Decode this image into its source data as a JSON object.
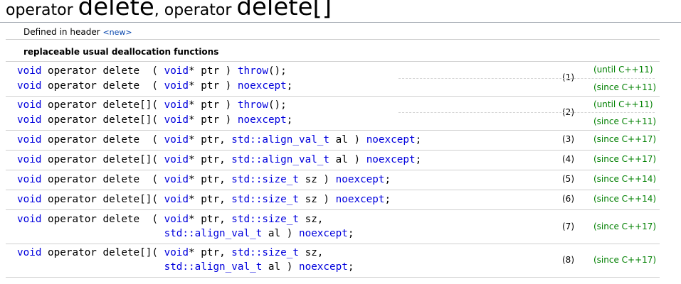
{
  "title": {
    "part1_small": "operator ",
    "part1_big": "delete",
    "sep": ", ",
    "part2_small": "operator ",
    "part2_big": "delete[]"
  },
  "header": {
    "label": "Defined in header ",
    "link": "<new>"
  },
  "section": {
    "title": "replaceable usual deallocation functions"
  },
  "tokens": {
    "void": "void",
    "op_delete": " operator delete  ",
    "op_delete_arr": " operator delete[]",
    "open": "( ",
    "voidptr": "void",
    "star_ptr": "* ptr",
    "close": " ) ",
    "throw": "throw",
    "throw_tail": "();",
    "noexcept": "noexcept",
    "semi": ";",
    "comma_space": ", ",
    "align_t": "std::align_val_t",
    "al": " al",
    "size_t": "std::size_t",
    "sz": " sz",
    "sz_comma": " sz,",
    "indent": "                        "
  },
  "numbers": [
    "(1)",
    "(2)",
    "(3)",
    "(4)",
    "(5)",
    "(6)",
    "(7)",
    "(8)"
  ],
  "standards": {
    "until11": "(until C++11)",
    "since11": "(since C++11)",
    "since14": "(since C++14)",
    "since17": "(since C++17)"
  }
}
